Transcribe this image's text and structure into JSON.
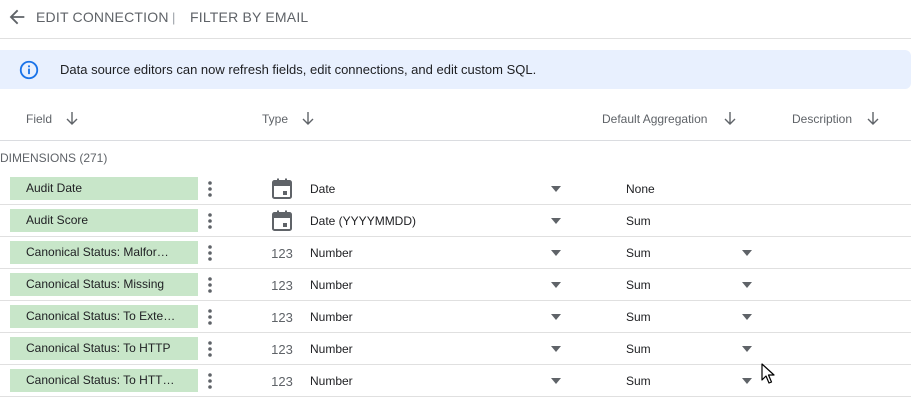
{
  "topbar": {
    "title": "EDIT CONNECTION",
    "separator": "|",
    "subtitle": "FILTER BY EMAIL",
    "back_icon": "arrow-back-icon"
  },
  "banner": {
    "icon": "info-icon",
    "text": "Data source editors can now refresh fields, edit connections, and edit custom SQL.",
    "bg": "#e8f0fe",
    "icon_color": "#1a73e8"
  },
  "table": {
    "headers": {
      "field": "Field",
      "type": "Type",
      "aggregation": "Default Aggregation",
      "description": "Description"
    },
    "section_label": "DIMENSIONS (271)",
    "chip_color": "#c8e6c9",
    "rows": [
      {
        "field": "Audit Date",
        "type_icon": "calendar-icon",
        "type": "Date",
        "aggregation": "None",
        "agg_dropdown": false
      },
      {
        "field": "Audit Score",
        "type_icon": "calendar-icon",
        "type": "Date (YYYYMMDD)",
        "aggregation": "Sum",
        "agg_dropdown": false
      },
      {
        "field": "Canonical Status: Malfor…",
        "type_icon": "number-icon",
        "type_glyph": "123",
        "type": "Number",
        "aggregation": "Sum",
        "agg_dropdown": true
      },
      {
        "field": "Canonical Status: Missing",
        "type_icon": "number-icon",
        "type_glyph": "123",
        "type": "Number",
        "aggregation": "Sum",
        "agg_dropdown": true
      },
      {
        "field": "Canonical Status: To Exte…",
        "type_icon": "number-icon",
        "type_glyph": "123",
        "type": "Number",
        "aggregation": "Sum",
        "agg_dropdown": true
      },
      {
        "field": "Canonical Status: To HTTP",
        "type_icon": "number-icon",
        "type_glyph": "123",
        "type": "Number",
        "aggregation": "Sum",
        "agg_dropdown": true
      },
      {
        "field": "Canonical Status: To HTT…",
        "type_icon": "number-icon",
        "type_glyph": "123",
        "type": "Number",
        "aggregation": "Sum",
        "agg_dropdown": true
      }
    ]
  }
}
